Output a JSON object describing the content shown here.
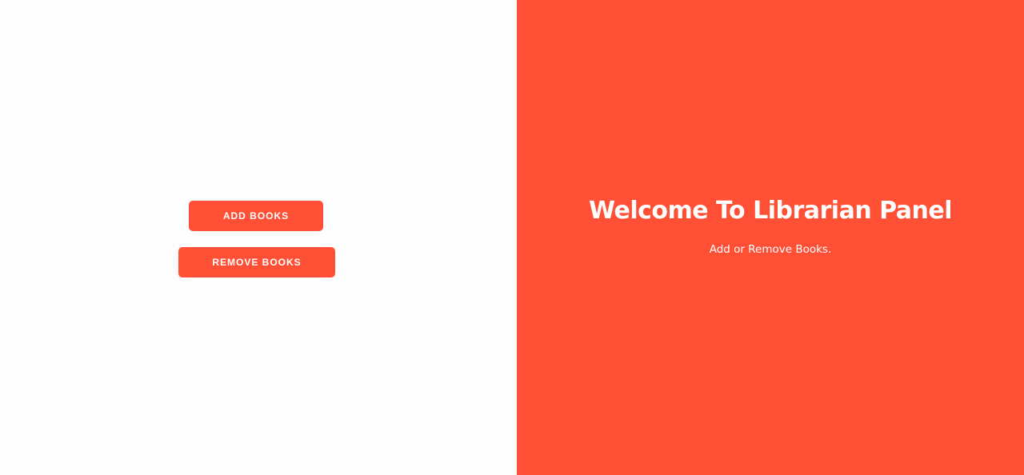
{
  "actions": {
    "add_books_label": "ADD BOOKS",
    "remove_books_label": "REMOVE BOOKS"
  },
  "welcome": {
    "title": "Welcome To Librarian Panel",
    "subtitle": "Add or Remove Books."
  },
  "colors": {
    "accent": "#ff4f35",
    "left_background": "#fdfdfd",
    "text_on_accent": "#ffffff"
  }
}
